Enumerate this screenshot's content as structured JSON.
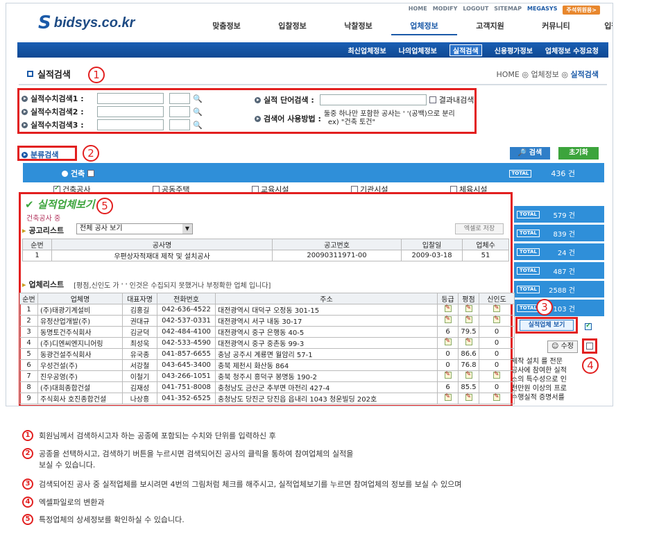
{
  "util": [
    "HOME",
    "MODIFY",
    "LOGOUT",
    "SITEMAP",
    "MEGASYS",
    "주석위원용>"
  ],
  "logo": "bidsys.co.kr",
  "gnb": [
    "맞춤정보",
    "입찰정보",
    "낙찰정보",
    "업체정보",
    "고객지원",
    "커뮤니티",
    "입찰도우미"
  ],
  "subnav": [
    "최신업체정보",
    "나의업체정보",
    "실적검색",
    "신용평가정보",
    "업체정보 수정요청"
  ],
  "page_title": "실적검색",
  "crumb": {
    "home": "HOME",
    "mid": "업체정보",
    "cur": "실적검색"
  },
  "search": {
    "num1": "실적수치검색1 :",
    "num2": "실적수치검색2 :",
    "num3": "실적수치검색3 :",
    "word_label": "실적 단어검색 :",
    "within": "결과내검색",
    "howto_label": "검색어 사용방법 :",
    "howto1": "둘중 하나만 포함한 공사는 ' '(공백)으로 분리",
    "howto2": "ex) \"건축 토건\""
  },
  "cat_label": "분류검색",
  "btn_search": "검색",
  "btn_reset": "초기화",
  "cat": {
    "title": "건축",
    "total": "TOTAL",
    "count": "436 건",
    "opts": [
      "건축공사",
      "공동주택",
      "교육시설",
      "기관시설",
      "체육시설"
    ]
  },
  "right_totals": [
    {
      "label": "TOTAL",
      "count": "579 건"
    },
    {
      "label": "TOTAL",
      "count": "839 건"
    },
    {
      "label": "TOTAL",
      "count": "24 건"
    },
    {
      "label": "TOTAL",
      "count": "487 건"
    },
    {
      "label": "TOTAL",
      "count": "2588 건"
    },
    {
      "label": "TOTAL",
      "count": "103 건"
    }
  ],
  "view_btn": "실적업체 보기",
  "edit_btn": "수정",
  "side_text": [
    "제작 설치 를 전문",
    "공사에 참여한 실적",
    "스의 특수성으로 인",
    "천만원 이상의 프로",
    "수행실적 증명서를"
  ],
  "popup": {
    "title": "실적업체보기",
    "sub": "건축공사 중",
    "list_label": "공고리스트",
    "select": "전체 공사 보기",
    "excel": "엑셀로 저장",
    "notice_headers": [
      "순번",
      "공사명",
      "공고번호",
      "입찰일",
      "업체수"
    ],
    "notice_row": [
      "1",
      "우편상자적재대 제작 및 설치공사",
      "20090311971-00",
      "2009-03-18",
      "51"
    ],
    "comp_label": "업체리스트",
    "comp_note": "[평점,신인도 가 ' ' 인것은 수집되지 못했거나 부정확한 업체 입니다]",
    "comp_headers": [
      "순번",
      "업체명",
      "대표자명",
      "전화번호",
      "주소",
      "등급",
      "평점",
      "신인도"
    ],
    "rows": [
      [
        "1",
        "(주)태광기계설비",
        "김홍길",
        "042-636-4522",
        "대전광역시 대덕구 오정동 301-15",
        "",
        "",
        ""
      ],
      [
        "2",
        "유정산업개발(주)",
        "권대규",
        "042-537-0331",
        "대전광역시 서구 내동 30-17",
        "",
        "",
        ""
      ],
      [
        "3",
        "동명토건주식회사",
        "김균덕",
        "042-484-4100",
        "대전광역시 중구 은행동 40-5",
        "6",
        "79.5",
        "0"
      ],
      [
        "4",
        "(주)디엔씨엔지니어링",
        "최성욱",
        "042-533-4590",
        "대전광역시 중구 중촌동 99-3",
        "",
        "",
        "0"
      ],
      [
        "5",
        "동광건설주식회사",
        "유국종",
        "041-857-6655",
        "충남 공주시 계룡면 월암리 57-1",
        "0",
        "86.6",
        "0"
      ],
      [
        "6",
        "우성건설(주)",
        "서강철",
        "043-645-3400",
        "충북 제천시 화산동 864",
        "0",
        "76.8",
        "0"
      ],
      [
        "7",
        "진우공영(주)",
        "이철기",
        "043-266-1051",
        "충북 청주시 흥덕구 봉명동 190-2",
        "",
        "",
        ""
      ],
      [
        "8",
        "(주)대희종합건설",
        "김재성",
        "041-751-8008",
        "충청남도 금산군 추부면 마전리 427-4",
        "6",
        "85.5",
        "0"
      ],
      [
        "9",
        "주식회사 호진종합건설",
        "나상흥",
        "041-352-6525",
        "충청남도 당진군 당진읍 읍내리 1043 청운빌딩 202호",
        "",
        "",
        ""
      ]
    ]
  },
  "markers": [
    "1",
    "2",
    "3",
    "4",
    "5"
  ],
  "legend": [
    {
      "n": "1",
      "t": "회원님께서 검색하시고자 하는 공종에 포함되는 수치와 단위를 입력하신 후"
    },
    {
      "n": "2",
      "t": "공종을 선택하시고, 검색하기 버튼을 누르시면 검색되어진 공사의 클릭을 통하여 참여업체의 실적을",
      "t2": "보실 수 있습니다."
    },
    {
      "n": "3",
      "t": "검색되어진 공사 중 실적업체를 보시려면 4번의 그림처럼 체크를 해주시고, 실적업체보기를 누르면 참여업체의 정보를 보실 수 있으며"
    },
    {
      "n": "4",
      "t": "엑셀파일로의 변환과"
    },
    {
      "n": "5",
      "t": "특정업체의 상세정보를 확인하실 수 있습니다."
    }
  ],
  "colors": {
    "brand": "#1b5aa8",
    "highlight": "#e21f1f",
    "panel": "#2f8fd9",
    "green": "#3ca43c"
  }
}
